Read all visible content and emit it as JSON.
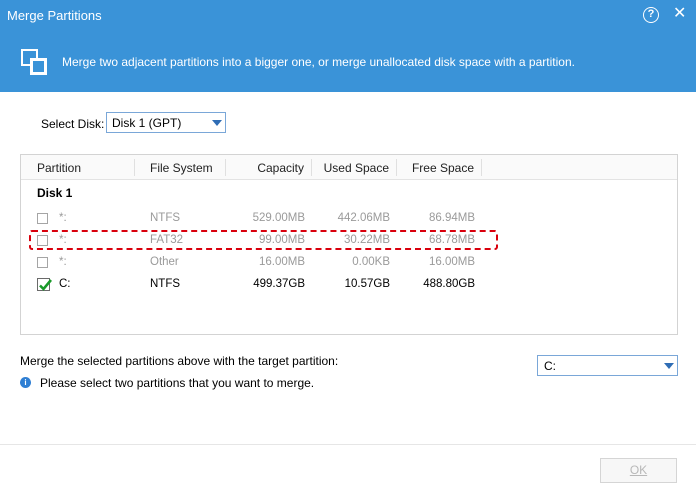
{
  "window": {
    "title": "Merge Partitions",
    "help_glyph": "?",
    "close_glyph": "✕"
  },
  "banner": {
    "description": "Merge two adjacent partitions into a bigger one, or merge unallocated disk space with a partition."
  },
  "disk_select": {
    "label": "Select Disk:",
    "value": "Disk 1 (GPT)"
  },
  "table": {
    "headers": {
      "partition": "Partition",
      "file_system": "File System",
      "capacity": "Capacity",
      "used": "Used Space",
      "free": "Free Space"
    },
    "group_label": "Disk 1",
    "rows": [
      {
        "partition": "*:",
        "file_system": "NTFS",
        "capacity": "529.00MB",
        "used": "442.06MB",
        "free": "86.94MB",
        "checked": false,
        "enabled": false
      },
      {
        "partition": "*:",
        "file_system": "FAT32",
        "capacity": "99.00MB",
        "used": "30.22MB",
        "free": "68.78MB",
        "checked": false,
        "enabled": false
      },
      {
        "partition": "*:",
        "file_system": "Other",
        "capacity": "16.00MB",
        "used": "0.00KB",
        "free": "16.00MB",
        "checked": false,
        "enabled": false
      },
      {
        "partition": "C:",
        "file_system": "NTFS",
        "capacity": "499.37GB",
        "used": "10.57GB",
        "free": "488.80GB",
        "checked": true,
        "enabled": true
      }
    ]
  },
  "target": {
    "label": "Merge the selected partitions above with the target partition:",
    "value": "C:"
  },
  "info": {
    "text": "Please select two partitions that you want to merge."
  },
  "buttons": {
    "ok": "OK"
  },
  "colors": {
    "accent": "#3a93d8",
    "highlight_dash": "#d9000d",
    "check_green": "#1a9a2a"
  }
}
